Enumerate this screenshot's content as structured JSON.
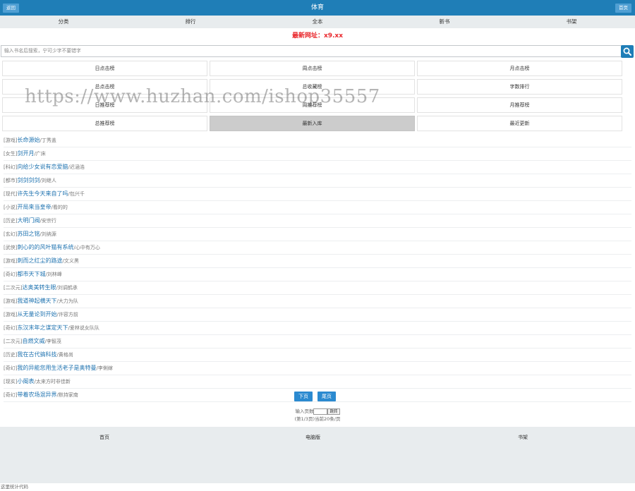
{
  "header": {
    "back_label": "返回",
    "title": "体育",
    "home_label": "首页"
  },
  "nav": {
    "items": [
      "分类",
      "排行",
      "全本",
      "新书",
      "书架"
    ]
  },
  "notice": "最新网址：x9.xx",
  "search": {
    "placeholder": "输入书名后搜索，宁可少字不要错字"
  },
  "ranks": [
    {
      "label": "日点击榜"
    },
    {
      "label": "周点击榜"
    },
    {
      "label": "月点击榜"
    },
    {
      "label": "总点击榜"
    },
    {
      "label": "总收藏榜"
    },
    {
      "label": "字数排行"
    },
    {
      "label": "日推荐榜"
    },
    {
      "label": "周推荐榜"
    },
    {
      "label": "月推荐榜"
    },
    {
      "label": "总推荐榜"
    },
    {
      "label": "最新入库",
      "active": true
    },
    {
      "label": "最近更新"
    }
  ],
  "watermark": "https://www.huzhan.com/ishop35557",
  "books": [
    {
      "category": "[游戏]",
      "title": "长命源始",
      "author": "/丁秀盖"
    },
    {
      "category": "[女生]",
      "title": "剑开月",
      "author": "/广床"
    },
    {
      "category": "[科幻]",
      "title": "向给少女说有恋爱脑",
      "author": "/迟涵浩"
    },
    {
      "category": "[都市]",
      "title": "剑剑剑剑",
      "author": "/刘继人"
    },
    {
      "category": "[现代]",
      "title": "许先生今天来自了吗",
      "author": "/包兴千"
    },
    {
      "category": "[小说]",
      "title": "开局来当皇帝",
      "author": "/看的的"
    },
    {
      "category": "[历史]",
      "title": "大明门阀",
      "author": "/安宗行"
    },
    {
      "category": "[玄幻]",
      "title": "苏田之铭",
      "author": "/刘纳源"
    },
    {
      "category": "[武侠]",
      "title": "刺心的的风叶猫有系统",
      "author": "/心中有万心"
    },
    {
      "category": "[游戏]",
      "title": "刺而之红尘的路途",
      "author": "/文义黑"
    },
    {
      "category": "[奇幻]",
      "title": "都市天下城",
      "author": "/刘林峰"
    },
    {
      "category": "[二次元]",
      "title": "达奥美转生眼",
      "author": "/刘调鹤承"
    },
    {
      "category": "[游戏]",
      "title": "我道神起横天下",
      "author": "/大力为队"
    },
    {
      "category": "[游戏]",
      "title": "从无量论到开始",
      "author": "/许容方前"
    },
    {
      "category": "[奇幻]",
      "title": "东汉末年之谋定天下",
      "author": "/爱林说女队队"
    },
    {
      "category": "[二次元]",
      "title": "自燃文威",
      "author": "/李智茂"
    },
    {
      "category": "[历史]",
      "title": "我在古代搞科技",
      "author": "/黄格尚"
    },
    {
      "category": "[奇幻]",
      "title": "我的异能您用生活老子是奥特曼",
      "author": "/李俐嫁"
    },
    {
      "category": "[现实]",
      "title": "小阁表",
      "author": "/太来方时非佳新"
    },
    {
      "category": "[奇幻]",
      "title": "带着农场混异界",
      "author": "/默持家南"
    }
  ],
  "pagination": {
    "next_label": "下页",
    "last_label": "尾页",
    "jump_label": "输入页数",
    "jump_button": "跳转",
    "info": "(第1/3页)当前20条/页"
  },
  "footer": {
    "items": [
      "首页",
      "电脑版",
      "书架"
    ]
  },
  "stat_code": "这里统计代码",
  "colors": {
    "header_bg": "#1f7eb7",
    "notice": "#e9262b",
    "link": "#1f73b0",
    "button": "#2b8ad0"
  }
}
